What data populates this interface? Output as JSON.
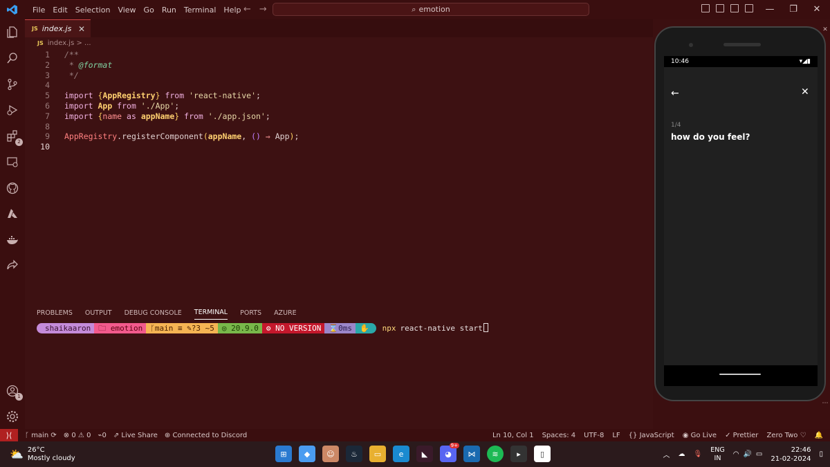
{
  "titlebar": {
    "menu": [
      "File",
      "Edit",
      "Selection",
      "View",
      "Go",
      "Run",
      "Terminal",
      "Help"
    ],
    "search": "emotion"
  },
  "activitybar": {
    "extensions_badge": "2",
    "accounts_badge": "1"
  },
  "editor": {
    "tab_label": "index.js",
    "tab_lang": "JS",
    "breadcrumb": "index.js > ...",
    "lines": [
      "1",
      "2",
      "3",
      "4",
      "5",
      "6",
      "7",
      "8",
      "9",
      "10"
    ],
    "code": {
      "l1": "/**",
      "l2_star": " * ",
      "l2_tag": "@format",
      "l3": " */",
      "l5_import": "import ",
      "l5_b1": "{",
      "l5_id": "AppRegistry",
      "l5_b2": "}",
      "l5_from": " from ",
      "l5_str": "'react-native'",
      "l5_semi": ";",
      "l6_import": "import ",
      "l6_id": "App",
      "l6_from": " from ",
      "l6_str": "'./App'",
      "l6_semi": ";",
      "l7_import": "import ",
      "l7_b1": "{",
      "l7_name": "name",
      "l7_as": " as ",
      "l7_id": "appName",
      "l7_b2": "}",
      "l7_from": " from ",
      "l7_str": "'./app.json'",
      "l7_semi": ";",
      "l9_cls": "AppRegistry",
      "l9_dot": ".",
      "l9_fn": "registerComponent",
      "l9_p1": "(",
      "l9_arg": "appName",
      "l9_comma": ", ",
      "l9_pp": "()",
      "l9_arrow": " ⇒ ",
      "l9_app": "App",
      "l9_p2": ")",
      "l9_semi": ";"
    }
  },
  "panel": {
    "tabs": [
      "PROBLEMS",
      "OUTPUT",
      "DEBUG CONSOLE",
      "TERMINAL",
      "PORTS",
      "AZURE"
    ],
    "prompt": {
      "user": "shaikaaron",
      "folder": "emotion",
      "git": "main ≡ ✎?3 ~5",
      "node": "◎ 20.9.0",
      "version": "NO VERSION",
      "time": "0ms",
      "cmd": "npx",
      "args": "react-native start"
    }
  },
  "phone": {
    "time": "10:46",
    "step": "1/4",
    "question": "how do you feel?"
  },
  "statusbar": {
    "branch": "main",
    "errors": "0",
    "warnings": "0",
    "ports": "0",
    "liveshare": "Live Share",
    "discord": "Connected to Discord",
    "position": "Ln 10, Col 1",
    "spaces": "Spaces: 4",
    "encoding": "UTF-8",
    "eol": "LF",
    "language": "JavaScript",
    "golive": "Go Live",
    "prettier": "Prettier",
    "theme": "Zero Two"
  },
  "taskbar": {
    "temp": "26°C",
    "weather": "Mostly cloudy",
    "lang1": "ENG",
    "lang2": "IN",
    "time": "22:46",
    "date": "21-02-2024",
    "discord_badge": "9+"
  },
  "colors": {
    "bg": "#3d1112",
    "accent": "#c44"
  }
}
